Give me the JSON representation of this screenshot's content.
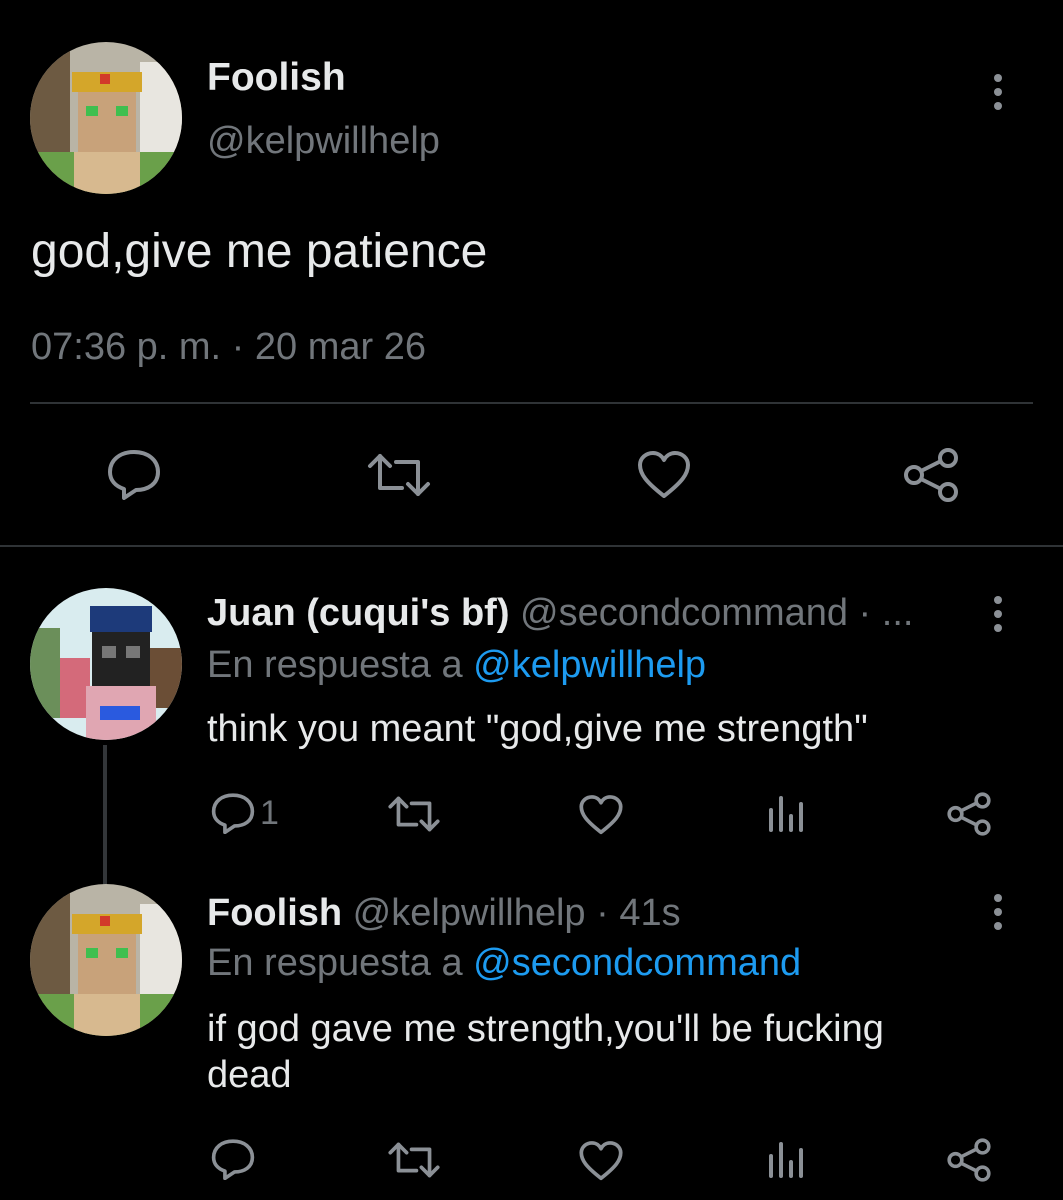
{
  "main_tweet": {
    "name": "Foolish",
    "handle": "@kelpwillhelp",
    "text": "god,give me patience",
    "timestamp": "07:36 p. m. · 20 mar 26",
    "actions": [
      "reply-icon",
      "retweet-icon",
      "like-icon",
      "share-icon"
    ]
  },
  "replies": [
    {
      "name": "Juan (cuqui's bf)",
      "meta": "@secondcommand · ...",
      "reply_prefix": "En respuesta a",
      "reply_to": "@kelpwillhelp",
      "text": "think you meant \"god,give me strength\"",
      "reply_count": "1",
      "actions": [
        "reply-icon",
        "retweet-icon",
        "like-icon",
        "stats-icon",
        "share-icon"
      ]
    },
    {
      "name": "Foolish",
      "meta": "@kelpwillhelp · 41s",
      "reply_prefix": "En respuesta a",
      "reply_to": "@secondcommand",
      "text_line1": "if god gave me strength,you'll be fucking",
      "text_line2": "dead",
      "actions": [
        "reply-icon",
        "retweet-icon",
        "like-icon",
        "stats-icon",
        "share-icon"
      ]
    }
  ],
  "colors": {
    "background": "#000000",
    "text": "#e7e9ea",
    "muted": "#71767b",
    "link": "#1d9bf0",
    "divider": "#2f3336"
  }
}
